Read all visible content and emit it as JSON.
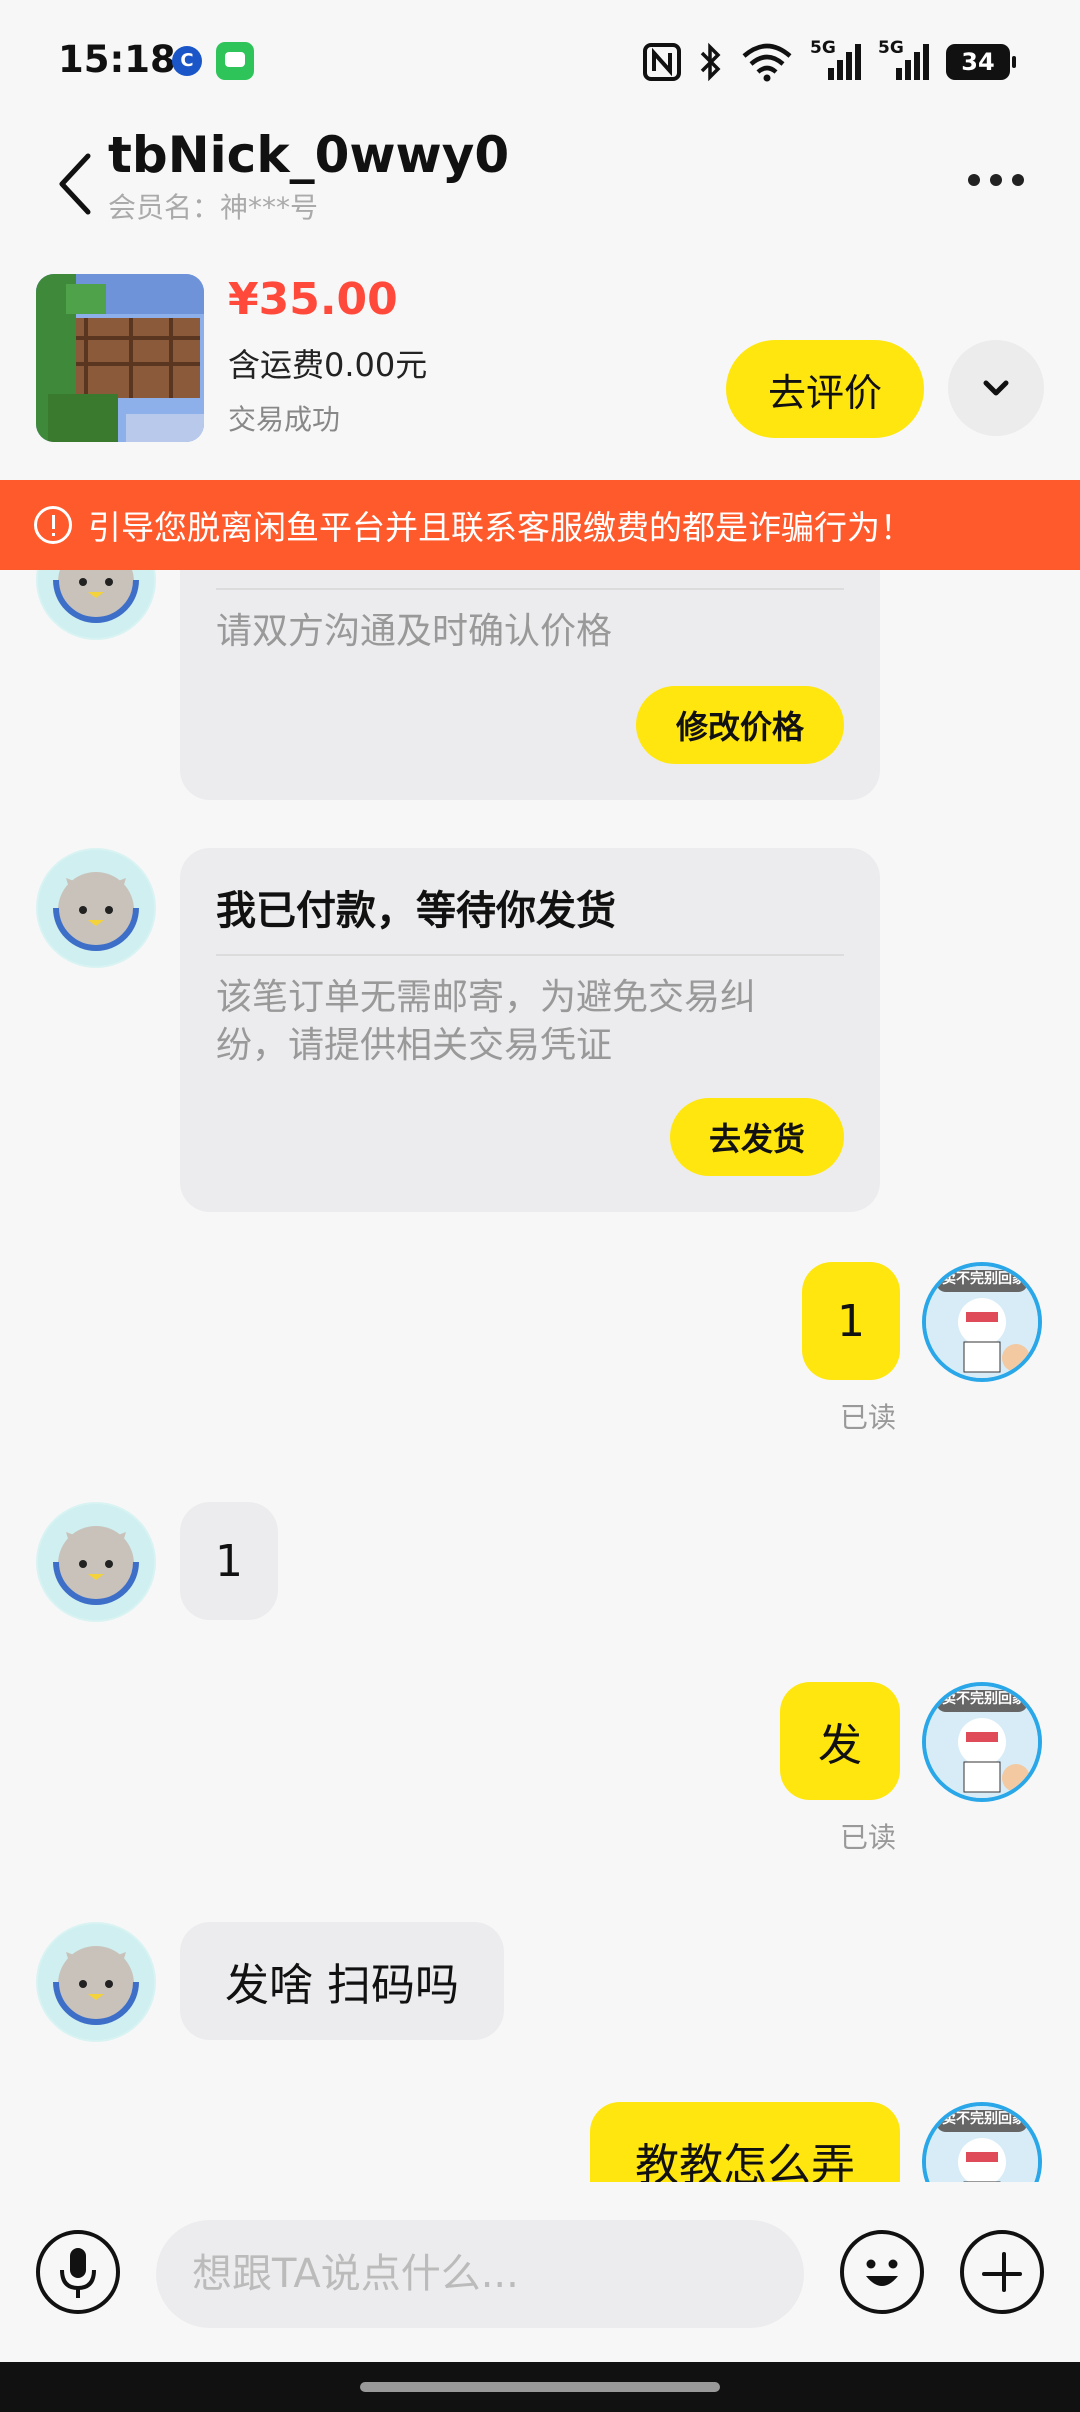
{
  "status_bar": {
    "time": "15:18",
    "network_1": "5G",
    "network_2": "5G",
    "battery": "34"
  },
  "header": {
    "title": "tbNick_0wwy0",
    "subtitle": "会员名：神***号"
  },
  "product": {
    "price": "¥35.00",
    "shipping": "含运费0.00元",
    "status": "交易成功",
    "review_button": "去评价"
  },
  "warning": {
    "text": "引导您脱离闲鱼平台并且联系客服缴费的都是诈骗行为！"
  },
  "messages": {
    "card1": {
      "text": "请双方沟通及时确认价格",
      "button": "修改价格"
    },
    "card2": {
      "title": "我已付款，等待你发货",
      "text": "该笔订单无需邮寄，为避免交易纠纷，请提供相关交易凭证",
      "button": "去发货"
    },
    "m1": {
      "text": "1",
      "read": "已读"
    },
    "m2": {
      "text": "1"
    },
    "m3": {
      "text": "发",
      "read": "已读"
    },
    "m4": {
      "text": "发啥 扫码吗"
    },
    "m5": {
      "text": "教教怎么弄"
    },
    "avatar_badge": "卖不完别回家"
  },
  "input": {
    "placeholder": "想跟TA说点什么..."
  },
  "colors": {
    "accent_yellow": "#ffe60f",
    "warning_orange": "#ff5a2c",
    "price_red": "#ff4a3b"
  }
}
